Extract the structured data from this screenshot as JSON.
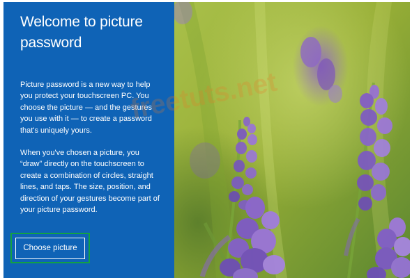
{
  "setup": {
    "title": "Welcome to picture password",
    "intro": "Picture password is a new way to help you protect your touchscreen PC. You choose the picture — and the gestures you use with it — to create a password that's uniquely yours.",
    "details": "When you've chosen a picture, you “draw” directly on the touchscreen to create a combination of circles, straight lines, and taps. The size, position, and direction of your gestures become part of your picture password.",
    "button_label": "Choose picture"
  },
  "watermark": {
    "text": "freetuts.net"
  },
  "colors": {
    "panel": "#0f63b6",
    "highlight": "#12a243",
    "watermark": "#ec7826"
  }
}
